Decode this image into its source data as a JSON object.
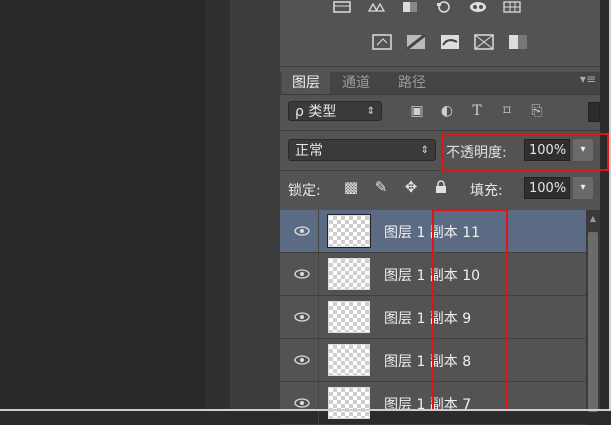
{
  "panel": {
    "tabs": [
      "图层",
      "通道",
      "路径"
    ],
    "filter_select": "ρ 类型",
    "blend_mode": "正常",
    "opacity_label": "不透明度:",
    "opacity_value": "100%",
    "lock_label": "锁定:",
    "fill_label": "填充:",
    "fill_value": "100%"
  },
  "layers": [
    {
      "name": "图层 1 副本 11",
      "selected": true
    },
    {
      "name": "图层 1 副本 10",
      "selected": false
    },
    {
      "name": "图层 1 副本 9",
      "selected": false
    },
    {
      "name": "图层 1 副本 8",
      "selected": false
    },
    {
      "name": "图层 1 副本 7",
      "selected": false
    }
  ],
  "colors": {
    "highlight": "#e01414",
    "selected_row": "#5b6b84"
  },
  "icons": {
    "top_row_1": [
      "grid-icon",
      "scale-icon",
      "rect-icon",
      "camera-icon",
      "eye-mask-icon",
      "table-icon"
    ],
    "top_row_2": [
      "frame-icon",
      "gradient-icon",
      "mask-icon",
      "cross-frame-icon",
      "fill-rect-icon"
    ],
    "filters": [
      "image-filter-icon",
      "circle-filter-icon",
      "text-filter-icon",
      "shape-filter-icon",
      "smart-filter-icon"
    ],
    "locks": [
      "lock-pixels-icon",
      "lock-brush-icon",
      "lock-move-icon",
      "lock-all-icon"
    ]
  }
}
